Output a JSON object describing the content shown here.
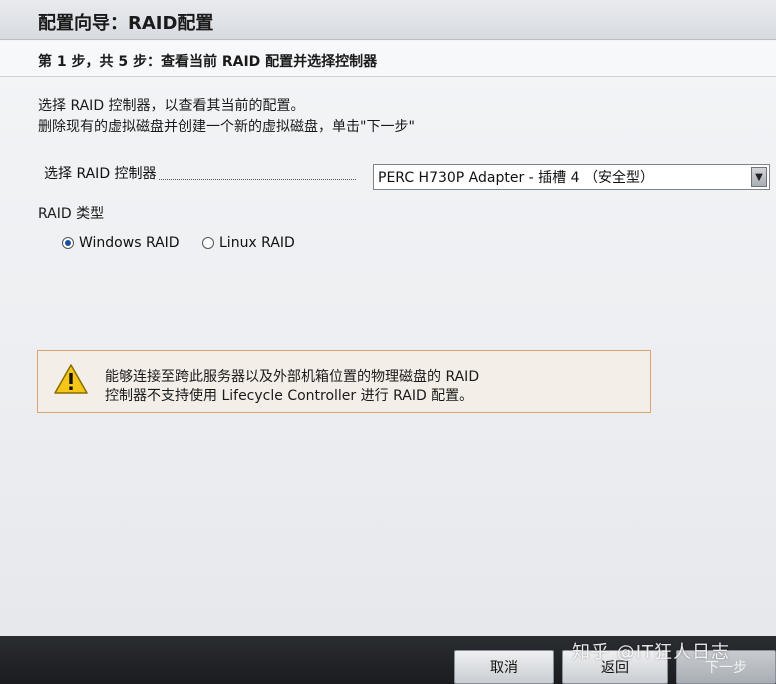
{
  "window": {
    "title": "配置向导：RAID配置",
    "step": "第 1 步，共 5 步：查看当前 RAID 配置并选择控制器"
  },
  "instructions": {
    "line1": "选择 RAID 控制器，以查看其当前的配置。",
    "line2": "删除现有的虚拟磁盘并创建一个新的虚拟磁盘，单击\"下一步\""
  },
  "controller": {
    "label": "选择 RAID 控制器",
    "selected": "PERC H730P Adapter - 插槽 4 （安全型）",
    "arrow": "▼"
  },
  "raid_type": {
    "label": "RAID 类型",
    "options": [
      {
        "label": "Windows RAID",
        "selected": true
      },
      {
        "label": "Linux RAID",
        "selected": false
      }
    ]
  },
  "warning": {
    "icon": "warning-icon",
    "line1": "能够连接至跨此服务器以及外部机箱位置的物理磁盘的 RAID",
    "line2": "控制器不支持使用 Lifecycle Controller 进行 RAID 配置。"
  },
  "footer": {
    "cancel": "取消",
    "back": "返回",
    "next": "下一步"
  },
  "watermark": "知乎 @IT狂人日志",
  "colors": {
    "warning_border": "#d9a46f",
    "warning_fill": "#f5c518",
    "radio_selected": "#1a4fa0"
  }
}
